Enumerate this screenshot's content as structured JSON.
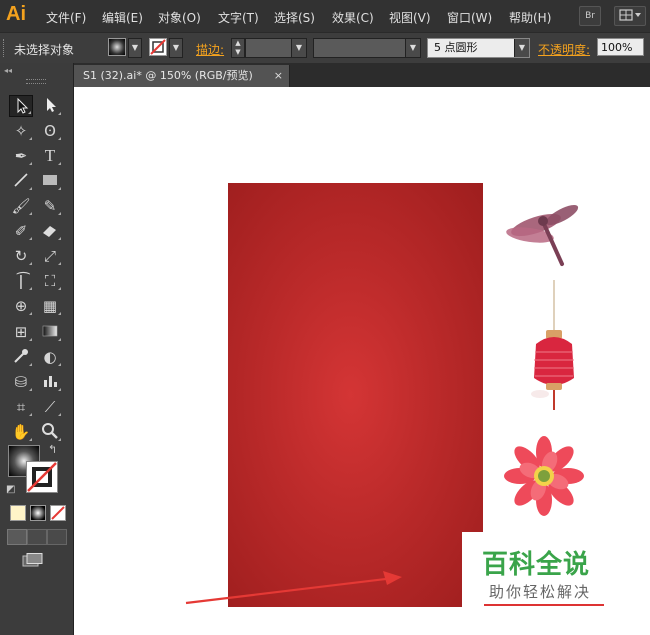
{
  "app": {
    "logo": "Ai"
  },
  "menubar": {
    "items": [
      "文件(F)",
      "编辑(E)",
      "对象(O)",
      "文字(T)",
      "选择(S)",
      "效果(C)",
      "视图(V)",
      "窗口(W)",
      "帮助(H)"
    ],
    "bridge_label": "Br"
  },
  "control": {
    "selection_status": "未选择对象",
    "stroke_label": "描边:",
    "brush_value": "5 点圆形",
    "opacity_label": "不透明度:",
    "opacity_value": "100%"
  },
  "document": {
    "tab_title": "S1 (32).ai* @ 150% (RGB/预览)",
    "close_glyph": "×"
  },
  "watermark": {
    "title": "百科全说",
    "subtitle": "助你轻松解决"
  },
  "colors": {
    "accent": "#f4a21e",
    "card_red": "#c22a2a",
    "watermark_green": "#3aa44a",
    "arrow_red": "#e53935"
  }
}
